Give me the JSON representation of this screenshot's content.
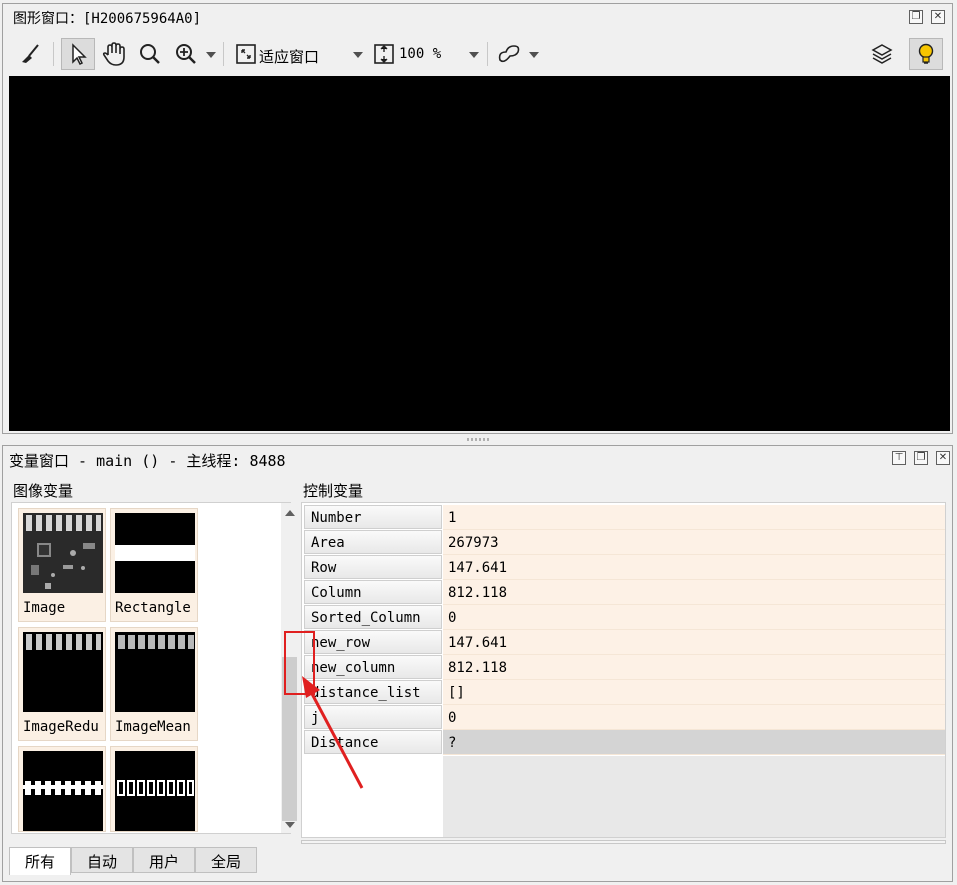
{
  "graphics_window": {
    "title": "图形窗口：[H200675964A0]",
    "toolbar": {
      "fit_window_label": "适应窗口",
      "zoom_label": "100 %"
    }
  },
  "variable_window": {
    "title": "变量窗口 - main () - 主线程: 8488",
    "iconic_section_label": "图像变量",
    "control_section_label": "控制变量",
    "iconic_variables": [
      {
        "name": "Image"
      },
      {
        "name": "Rectangle"
      },
      {
        "name": "ImageRedu"
      },
      {
        "name": "ImageMean"
      },
      {
        "name": ""
      },
      {
        "name": ""
      }
    ],
    "control_variables": [
      {
        "name": "Number",
        "value": "1"
      },
      {
        "name": "Area",
        "value": "267973"
      },
      {
        "name": "Row",
        "value": "147.641"
      },
      {
        "name": "Column",
        "value": "812.118"
      },
      {
        "name": "Sorted_Column",
        "value": "0"
      },
      {
        "name": "new_row",
        "value": "147.641"
      },
      {
        "name": "new_column",
        "value": "812.118"
      },
      {
        "name": "distance_list",
        "value": "[]"
      },
      {
        "name": "j",
        "value": "0"
      },
      {
        "name": "Distance",
        "value": "?"
      }
    ],
    "tabs": [
      "所有",
      "自动",
      "用户",
      "全局"
    ],
    "active_tab": "所有"
  },
  "colors": {
    "canvas": "#000000",
    "value_bg": "#fdf1e6",
    "thumb_bg": "#fbf0e4",
    "annotation": "#e02020"
  }
}
